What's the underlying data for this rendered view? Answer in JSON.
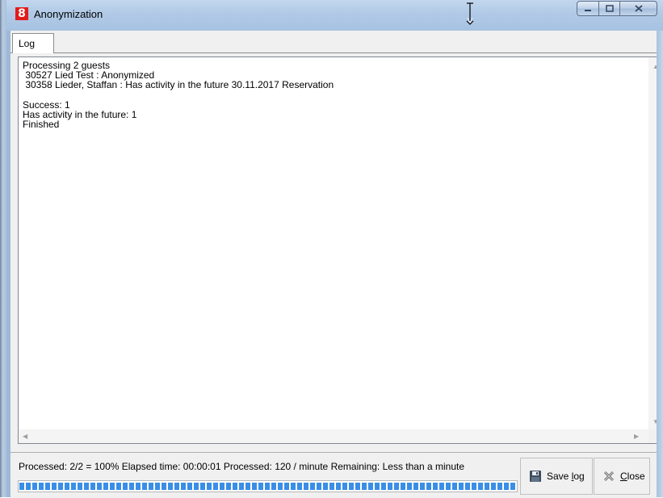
{
  "window": {
    "app_icon_glyph": "8",
    "title": "Anonymization",
    "accent": "#e21b1b"
  },
  "tabs": [
    {
      "label": "Log",
      "selected": true
    }
  ],
  "log": {
    "lines": [
      "Processing 2 guests",
      " 30527 Lied Test : Anonymized",
      " 30358 Lieder, Staffan : Has activity in the future 30.11.2017 Reservation",
      "",
      "Success: 1",
      "Has activity in the future: 1",
      "Finished"
    ]
  },
  "status": {
    "text": "Processed: 2/2 = 100%  Elapsed time: 00:00:01  Processed: 120 / minute  Remaining: Less than a minute",
    "progress_fraction": 1.0,
    "progress_color": "#3a8ee6"
  },
  "buttons": {
    "save_prefix": "Save ",
    "save_underlined": "l",
    "save_suffix": "og",
    "close_underlined": "C",
    "close_suffix": "lose"
  },
  "icons": {
    "window_controls": [
      "minimize-icon",
      "maximize-icon",
      "close-icon"
    ],
    "save": "floppy-disk-icon",
    "close": "close-x-icon",
    "cursor": "text-cursor-icon"
  }
}
